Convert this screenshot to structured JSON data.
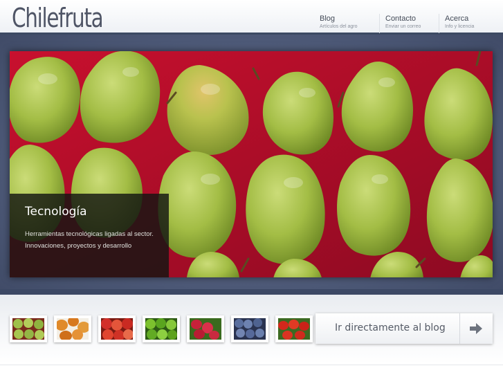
{
  "site": {
    "logo": "Chilefruta"
  },
  "nav": [
    {
      "title": "Blog",
      "sub": "Artículos del agro"
    },
    {
      "title": "Contacto",
      "sub": "Enviar un correo"
    },
    {
      "title": "Acerca",
      "sub": "Info y licencia"
    }
  ],
  "slide": {
    "image": "green-pears-on-red-tray",
    "title": "Tecnología",
    "text": "Herramientas tecnológicas ligadas al sector. Innovaciones, proyectos y desarrollo"
  },
  "thumbnails": [
    {
      "name": "thumb-green-fruit"
    },
    {
      "name": "thumb-orange-fruit"
    },
    {
      "name": "thumb-red-apples"
    },
    {
      "name": "thumb-limes"
    },
    {
      "name": "thumb-raspberries"
    },
    {
      "name": "thumb-blueberries"
    },
    {
      "name": "thumb-tomatoes"
    }
  ],
  "blog_button": {
    "label": "Ir directamente al blog",
    "icon": "arrow-right-icon"
  },
  "colors": {
    "header_bar": "#3c4a63",
    "band": "#56627f",
    "slide_bg": "#b8122c",
    "pear": "#a9c24a"
  }
}
